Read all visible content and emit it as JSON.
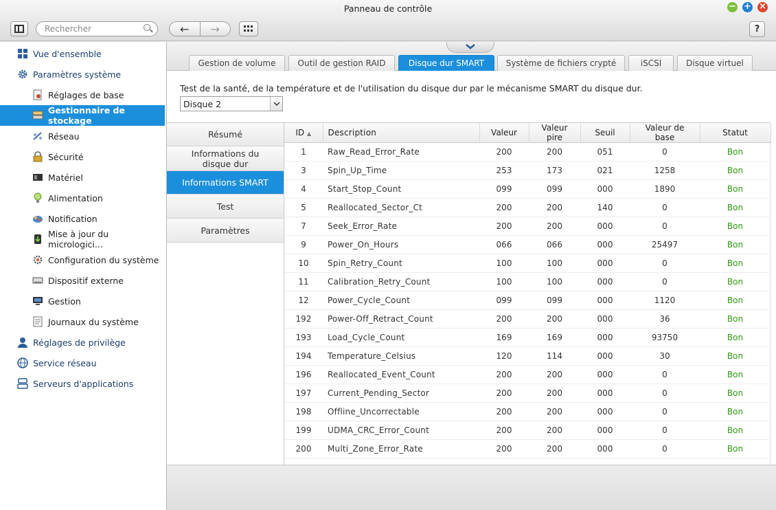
{
  "window": {
    "title": "Panneau de contrôle",
    "controls": {
      "minimize": "−",
      "maximize": "+",
      "close": "×"
    }
  },
  "toolbar": {
    "search_placeholder": "Rechercher",
    "back_icon": "←",
    "forward_icon": "→",
    "help_label": "?"
  },
  "sidebar": {
    "items": [
      {
        "label": "Vue d'ensemble",
        "icon": "grid-icon",
        "level": 1
      },
      {
        "label": "Paramètres système",
        "icon": "gear-icon",
        "level": 1
      },
      {
        "label": "Réglages de base",
        "icon": "settings-doc-icon",
        "level": 2
      },
      {
        "label": "Gestionnaire de stockage",
        "icon": "storage-icon",
        "level": 2,
        "active": true
      },
      {
        "label": "Réseau",
        "icon": "network-icon",
        "level": 2
      },
      {
        "label": "Sécurité",
        "icon": "lock-icon",
        "level": 2
      },
      {
        "label": "Matériel",
        "icon": "hardware-icon",
        "level": 2
      },
      {
        "label": "Alimentation",
        "icon": "bulb-icon",
        "level": 2
      },
      {
        "label": "Notification",
        "icon": "notification-icon",
        "level": 2
      },
      {
        "label": "Mise à jour du micrologici...",
        "icon": "firmware-icon",
        "level": 2
      },
      {
        "label": "Configuration du système",
        "icon": "system-config-icon",
        "level": 2
      },
      {
        "label": "Dispositif externe",
        "icon": "external-device-icon",
        "level": 2
      },
      {
        "label": "Gestion",
        "icon": "monitor-icon",
        "level": 2
      },
      {
        "label": "Journaux du système",
        "icon": "log-icon",
        "level": 2
      },
      {
        "label": "Réglages de privilège",
        "icon": "user-icon",
        "level": 1
      },
      {
        "label": "Service réseau",
        "icon": "globe-icon",
        "level": 1
      },
      {
        "label": "Serveurs d'applications",
        "icon": "server-icon",
        "level": 1
      }
    ]
  },
  "tabs": [
    {
      "label": "Gestion de volume"
    },
    {
      "label": "Outil de gestion RAID"
    },
    {
      "label": "Disque dur SMART",
      "active": true
    },
    {
      "label": "Système de fichiers crypté"
    },
    {
      "label": "iSCSI"
    },
    {
      "label": "Disque virtuel"
    }
  ],
  "content": {
    "description": "Test de la santé, de la température et de l'utilisation du disque dur par le mécanisme SMART du disque dur.",
    "disk_select": "Disque 2"
  },
  "subnav": [
    {
      "label": "Résumé"
    },
    {
      "label": "Informations du disque dur"
    },
    {
      "label": "Informations SMART",
      "active": true
    },
    {
      "label": "Test"
    },
    {
      "label": "Paramètres"
    }
  ],
  "table": {
    "headers": {
      "id": "ID",
      "description": "Description",
      "value": "Valeur",
      "worst": "Valeur pire",
      "threshold": "Seuil",
      "raw": "Valeur de base",
      "status": "Statut"
    },
    "sort_indicator": "▲",
    "rows": [
      [
        "1",
        "Raw_Read_Error_Rate",
        "200",
        "200",
        "051",
        "0",
        "Bon"
      ],
      [
        "3",
        "Spin_Up_Time",
        "253",
        "173",
        "021",
        "1258",
        "Bon"
      ],
      [
        "4",
        "Start_Stop_Count",
        "099",
        "099",
        "000",
        "1890",
        "Bon"
      ],
      [
        "5",
        "Reallocated_Sector_Ct",
        "200",
        "200",
        "140",
        "0",
        "Bon"
      ],
      [
        "7",
        "Seek_Error_Rate",
        "200",
        "200",
        "000",
        "0",
        "Bon"
      ],
      [
        "9",
        "Power_On_Hours",
        "066",
        "066",
        "000",
        "25497",
        "Bon"
      ],
      [
        "10",
        "Spin_Retry_Count",
        "100",
        "100",
        "000",
        "0",
        "Bon"
      ],
      [
        "11",
        "Calibration_Retry_Count",
        "100",
        "100",
        "000",
        "0",
        "Bon"
      ],
      [
        "12",
        "Power_Cycle_Count",
        "099",
        "099",
        "000",
        "1120",
        "Bon"
      ],
      [
        "192",
        "Power-Off_Retract_Count",
        "200",
        "200",
        "000",
        "36",
        "Bon"
      ],
      [
        "193",
        "Load_Cycle_Count",
        "169",
        "169",
        "000",
        "93750",
        "Bon"
      ],
      [
        "194",
        "Temperature_Celsius",
        "120",
        "114",
        "000",
        "30",
        "Bon"
      ],
      [
        "196",
        "Reallocated_Event_Count",
        "200",
        "200",
        "000",
        "0",
        "Bon"
      ],
      [
        "197",
        "Current_Pending_Sector",
        "200",
        "200",
        "000",
        "0",
        "Bon"
      ],
      [
        "198",
        "Offline_Uncorrectable",
        "200",
        "200",
        "000",
        "0",
        "Bon"
      ],
      [
        "199",
        "UDMA_CRC_Error_Count",
        "200",
        "200",
        "000",
        "0",
        "Bon"
      ],
      [
        "200",
        "Multi_Zone_Error_Rate",
        "200",
        "200",
        "000",
        "0",
        "Bon"
      ]
    ]
  },
  "colors": {
    "accent": "#1c8fdc",
    "status_ok": "#2e9a10",
    "link": "#1a3c6e"
  }
}
